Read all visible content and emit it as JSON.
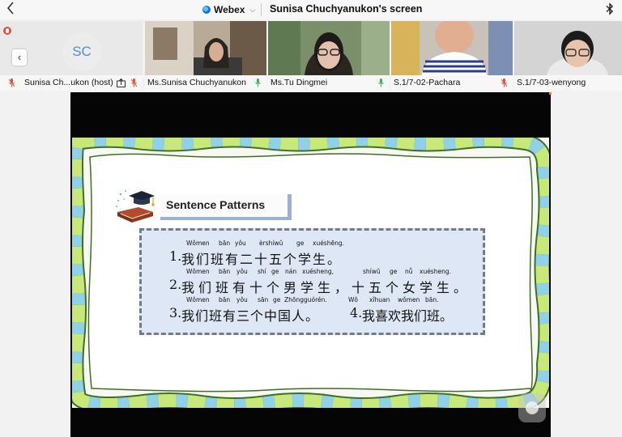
{
  "topbar": {
    "app_name": "Webex",
    "screen_title": "Sunisa Chuchyanukon's screen",
    "icons": {
      "back": "chevron-left-icon",
      "app": "webex-logo-icon",
      "caret": "chevron-down-icon",
      "bluetooth": "bluetooth-icon"
    }
  },
  "participants": [
    {
      "name": "Sunisa Ch...ukon (host)",
      "initials": "SC",
      "video": false,
      "muted": true
    },
    {
      "name": "Ms.Sunisa Chuchyanukon",
      "video": true,
      "muted": false
    },
    {
      "name": "Ms.Tu Dingmei",
      "video": true,
      "muted": false
    },
    {
      "name": "S.1/7-02-Pachara",
      "video": true,
      "muted": true
    },
    {
      "name": "S.1/7-03-wenyong",
      "video": true,
      "muted": false
    }
  ],
  "slide": {
    "heading": "Sentence Patterns",
    "sentences": [
      {
        "pinyin": [
          "Wǒmen",
          "bān",
          "yǒu",
          "èrshíwǔ",
          "ge",
          "xuéshēng."
        ],
        "number": "1.",
        "hanzi": "我们班有二十五个学生。"
      },
      {
        "pinyin": [
          "Wǒmen",
          "bān",
          "yǒu",
          "shí",
          "ge",
          "nán",
          "xuésheng,",
          "shíwǔ",
          "ge",
          "nǚ",
          "xuésheng."
        ],
        "number": "2.",
        "hanzi": "我们班有十个男学生，十五个女学生。"
      },
      {
        "pinyin_a": [
          "Wǒmen",
          "bān",
          "yǒu",
          "sān",
          "ge",
          "Zhōngguórén."
        ],
        "number_a": "3.",
        "hanzi_a": "我们班有三个中国人。",
        "pinyin_b": [
          "Wǒ",
          "xǐhuan",
          "wǒmen",
          "bān."
        ],
        "number_b": "4.",
        "hanzi_b": "我喜欢我们班。"
      }
    ]
  },
  "colors": {
    "frame_green": "#c9e87a",
    "frame_blue": "#8fd1e8",
    "frame_outline": "#3f6f25",
    "pattern_bg": "#dde7f5"
  }
}
